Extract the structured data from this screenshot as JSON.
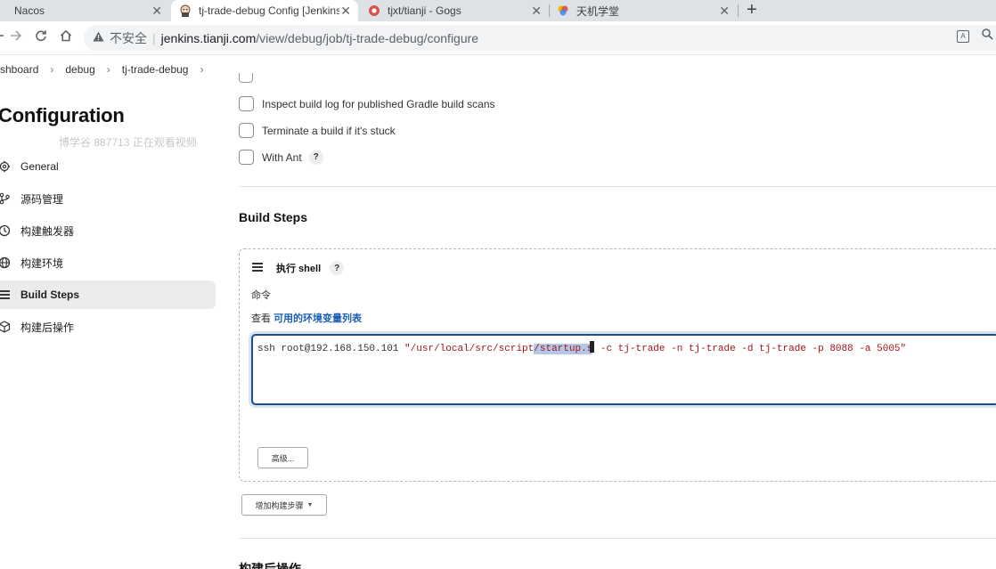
{
  "browser": {
    "tabs": [
      {
        "title": "Nacos",
        "icon": "nacos-favicon"
      },
      {
        "title": "tj-trade-debug Config [Jenkins]",
        "icon": "jenkins-favicon"
      },
      {
        "title": "tjxt/tianji - Gogs",
        "icon": "gogs-favicon"
      },
      {
        "title": "天机学堂",
        "icon": "tianji-favicon"
      }
    ],
    "close_glyph": "✕",
    "new_tab": "+",
    "security_label": "不安全",
    "url_host": "jenkins.tianji.com",
    "url_path": "/view/debug/job/tj-trade-debug/configure"
  },
  "breadcrumb": [
    "shboard",
    "debug",
    "tj-trade-debug"
  ],
  "sidebar": {
    "title": "Configuration",
    "watermark": "博学谷 887713 正在观看视频",
    "items": [
      {
        "label": "General",
        "icon": "gear-icon",
        "active": false
      },
      {
        "label": "源码管理",
        "icon": "branch-icon",
        "active": false
      },
      {
        "label": "构建触发器",
        "icon": "clock-icon",
        "active": false
      },
      {
        "label": "构建环境",
        "icon": "globe-icon",
        "active": false
      },
      {
        "label": "Build Steps",
        "icon": "list-icon",
        "active": true
      },
      {
        "label": "构建后操作",
        "icon": "cube-icon",
        "active": false
      }
    ]
  },
  "build_env_options": [
    {
      "label": "Inspect build log for published Gradle build scans",
      "checked": false,
      "help": false
    },
    {
      "label": "Terminate a build if it's stuck",
      "checked": false,
      "help": false
    },
    {
      "label": "With Ant",
      "checked": false,
      "help": true
    }
  ],
  "help_glyph": "?",
  "build_steps": {
    "title": "Build Steps",
    "step_title": "执行 shell",
    "command_label": "命令",
    "env_prefix": "查看 ",
    "env_link": "可用的环境变量列表",
    "command": {
      "before": "ssh root@192.168.150.101 ",
      "str_before": "\"/usr/local/src/script",
      "selected": "/startup.s",
      "str_after": " -c tj-trade -n tj-trade -d tj-trade -p 8088 -a 5005\""
    },
    "advanced_button": "高级...",
    "add_step_button": "增加构建步骤"
  },
  "post_build": {
    "title": "构建后操作"
  }
}
